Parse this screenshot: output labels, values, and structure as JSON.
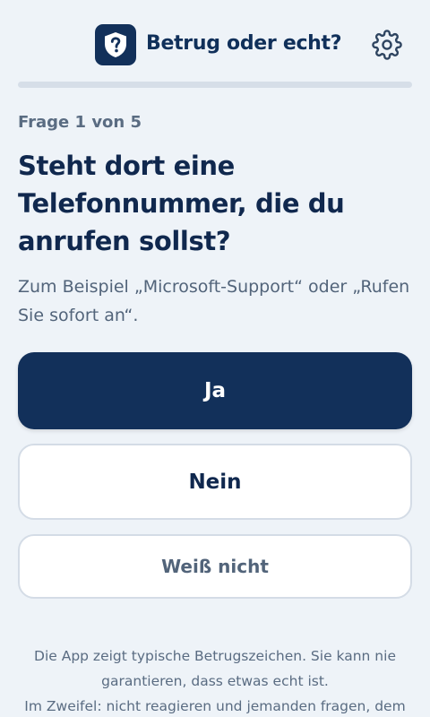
{
  "header": {
    "title": "Betrug oder echt?",
    "logo_icon": "shield-question-icon",
    "settings_icon": "gear-icon"
  },
  "progress": {
    "label": "Frage 1 von 5",
    "current": 1,
    "total": 5,
    "fraction": 0.0
  },
  "question": {
    "text": "Steht dort eine Telefonnummer, die du anrufen sollst?",
    "hint": "Zum Beispiel „Microsoft-Support“ oder „Rufen Sie sofort an“."
  },
  "answers": {
    "yes": "Ja",
    "no": "Nein",
    "unsure": "Weiß nicht"
  },
  "footer": {
    "line1": "Die App zeigt typische Betrugszeichen. Sie kann nie garantieren, dass etwas echt ist.",
    "line2": "Im Zweifel: nicht reagieren und jemanden fragen, dem du"
  },
  "colors": {
    "primary": "#12305a",
    "background": "#eef3f8",
    "muted_text": "#5a6c82"
  }
}
